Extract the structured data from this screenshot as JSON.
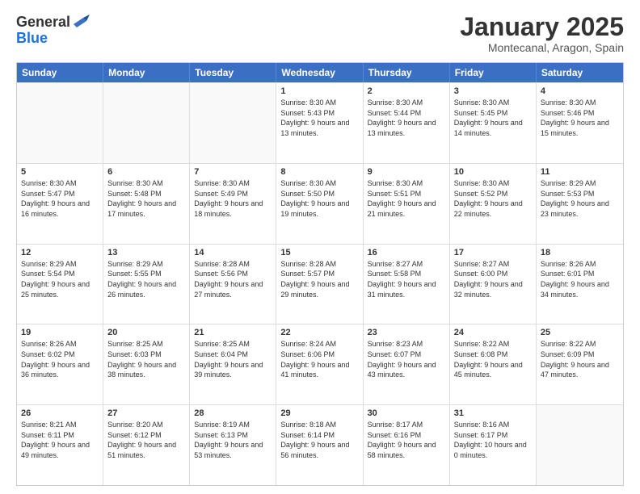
{
  "logo": {
    "general": "General",
    "blue": "Blue"
  },
  "title": {
    "month": "January 2025",
    "location": "Montecanal, Aragon, Spain"
  },
  "days_of_week": [
    "Sunday",
    "Monday",
    "Tuesday",
    "Wednesday",
    "Thursday",
    "Friday",
    "Saturday"
  ],
  "rows": [
    [
      {
        "day": "",
        "sunrise": "",
        "sunset": "",
        "daylight": ""
      },
      {
        "day": "",
        "sunrise": "",
        "sunset": "",
        "daylight": ""
      },
      {
        "day": "",
        "sunrise": "",
        "sunset": "",
        "daylight": ""
      },
      {
        "day": "1",
        "sunrise": "Sunrise: 8:30 AM",
        "sunset": "Sunset: 5:43 PM",
        "daylight": "Daylight: 9 hours and 13 minutes."
      },
      {
        "day": "2",
        "sunrise": "Sunrise: 8:30 AM",
        "sunset": "Sunset: 5:44 PM",
        "daylight": "Daylight: 9 hours and 13 minutes."
      },
      {
        "day": "3",
        "sunrise": "Sunrise: 8:30 AM",
        "sunset": "Sunset: 5:45 PM",
        "daylight": "Daylight: 9 hours and 14 minutes."
      },
      {
        "day": "4",
        "sunrise": "Sunrise: 8:30 AM",
        "sunset": "Sunset: 5:46 PM",
        "daylight": "Daylight: 9 hours and 15 minutes."
      }
    ],
    [
      {
        "day": "5",
        "sunrise": "Sunrise: 8:30 AM",
        "sunset": "Sunset: 5:47 PM",
        "daylight": "Daylight: 9 hours and 16 minutes."
      },
      {
        "day": "6",
        "sunrise": "Sunrise: 8:30 AM",
        "sunset": "Sunset: 5:48 PM",
        "daylight": "Daylight: 9 hours and 17 minutes."
      },
      {
        "day": "7",
        "sunrise": "Sunrise: 8:30 AM",
        "sunset": "Sunset: 5:49 PM",
        "daylight": "Daylight: 9 hours and 18 minutes."
      },
      {
        "day": "8",
        "sunrise": "Sunrise: 8:30 AM",
        "sunset": "Sunset: 5:50 PM",
        "daylight": "Daylight: 9 hours and 19 minutes."
      },
      {
        "day": "9",
        "sunrise": "Sunrise: 8:30 AM",
        "sunset": "Sunset: 5:51 PM",
        "daylight": "Daylight: 9 hours and 21 minutes."
      },
      {
        "day": "10",
        "sunrise": "Sunrise: 8:30 AM",
        "sunset": "Sunset: 5:52 PM",
        "daylight": "Daylight: 9 hours and 22 minutes."
      },
      {
        "day": "11",
        "sunrise": "Sunrise: 8:29 AM",
        "sunset": "Sunset: 5:53 PM",
        "daylight": "Daylight: 9 hours and 23 minutes."
      }
    ],
    [
      {
        "day": "12",
        "sunrise": "Sunrise: 8:29 AM",
        "sunset": "Sunset: 5:54 PM",
        "daylight": "Daylight: 9 hours and 25 minutes."
      },
      {
        "day": "13",
        "sunrise": "Sunrise: 8:29 AM",
        "sunset": "Sunset: 5:55 PM",
        "daylight": "Daylight: 9 hours and 26 minutes."
      },
      {
        "day": "14",
        "sunrise": "Sunrise: 8:28 AM",
        "sunset": "Sunset: 5:56 PM",
        "daylight": "Daylight: 9 hours and 27 minutes."
      },
      {
        "day": "15",
        "sunrise": "Sunrise: 8:28 AM",
        "sunset": "Sunset: 5:57 PM",
        "daylight": "Daylight: 9 hours and 29 minutes."
      },
      {
        "day": "16",
        "sunrise": "Sunrise: 8:27 AM",
        "sunset": "Sunset: 5:58 PM",
        "daylight": "Daylight: 9 hours and 31 minutes."
      },
      {
        "day": "17",
        "sunrise": "Sunrise: 8:27 AM",
        "sunset": "Sunset: 6:00 PM",
        "daylight": "Daylight: 9 hours and 32 minutes."
      },
      {
        "day": "18",
        "sunrise": "Sunrise: 8:26 AM",
        "sunset": "Sunset: 6:01 PM",
        "daylight": "Daylight: 9 hours and 34 minutes."
      }
    ],
    [
      {
        "day": "19",
        "sunrise": "Sunrise: 8:26 AM",
        "sunset": "Sunset: 6:02 PM",
        "daylight": "Daylight: 9 hours and 36 minutes."
      },
      {
        "day": "20",
        "sunrise": "Sunrise: 8:25 AM",
        "sunset": "Sunset: 6:03 PM",
        "daylight": "Daylight: 9 hours and 38 minutes."
      },
      {
        "day": "21",
        "sunrise": "Sunrise: 8:25 AM",
        "sunset": "Sunset: 6:04 PM",
        "daylight": "Daylight: 9 hours and 39 minutes."
      },
      {
        "day": "22",
        "sunrise": "Sunrise: 8:24 AM",
        "sunset": "Sunset: 6:06 PM",
        "daylight": "Daylight: 9 hours and 41 minutes."
      },
      {
        "day": "23",
        "sunrise": "Sunrise: 8:23 AM",
        "sunset": "Sunset: 6:07 PM",
        "daylight": "Daylight: 9 hours and 43 minutes."
      },
      {
        "day": "24",
        "sunrise": "Sunrise: 8:22 AM",
        "sunset": "Sunset: 6:08 PM",
        "daylight": "Daylight: 9 hours and 45 minutes."
      },
      {
        "day": "25",
        "sunrise": "Sunrise: 8:22 AM",
        "sunset": "Sunset: 6:09 PM",
        "daylight": "Daylight: 9 hours and 47 minutes."
      }
    ],
    [
      {
        "day": "26",
        "sunrise": "Sunrise: 8:21 AM",
        "sunset": "Sunset: 6:11 PM",
        "daylight": "Daylight: 9 hours and 49 minutes."
      },
      {
        "day": "27",
        "sunrise": "Sunrise: 8:20 AM",
        "sunset": "Sunset: 6:12 PM",
        "daylight": "Daylight: 9 hours and 51 minutes."
      },
      {
        "day": "28",
        "sunrise": "Sunrise: 8:19 AM",
        "sunset": "Sunset: 6:13 PM",
        "daylight": "Daylight: 9 hours and 53 minutes."
      },
      {
        "day": "29",
        "sunrise": "Sunrise: 8:18 AM",
        "sunset": "Sunset: 6:14 PM",
        "daylight": "Daylight: 9 hours and 56 minutes."
      },
      {
        "day": "30",
        "sunrise": "Sunrise: 8:17 AM",
        "sunset": "Sunset: 6:16 PM",
        "daylight": "Daylight: 9 hours and 58 minutes."
      },
      {
        "day": "31",
        "sunrise": "Sunrise: 8:16 AM",
        "sunset": "Sunset: 6:17 PM",
        "daylight": "Daylight: 10 hours and 0 minutes."
      },
      {
        "day": "",
        "sunrise": "",
        "sunset": "",
        "daylight": ""
      }
    ]
  ]
}
